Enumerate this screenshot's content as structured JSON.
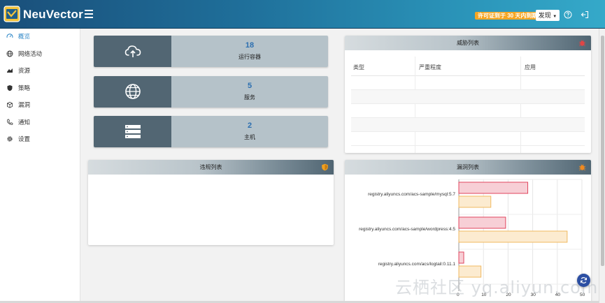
{
  "header": {
    "brand": "NeuVector",
    "license_notice": "许可证到于 30 天内到期!",
    "discover_label": "发现",
    "colors": {
      "topbar_start": "#1a4f7a",
      "topbar_end": "#35a9c9",
      "license_bg": "#f5a623"
    }
  },
  "sidebar": {
    "items": [
      {
        "label": "概览",
        "icon": "dashboard-icon",
        "active": true
      },
      {
        "label": "网络活动",
        "icon": "globe-icon",
        "active": false
      },
      {
        "label": "资源",
        "icon": "resources-icon",
        "active": false
      },
      {
        "label": "策略",
        "icon": "shield-icon",
        "active": false
      },
      {
        "label": "漏洞",
        "icon": "box-icon",
        "active": false
      },
      {
        "label": "通知",
        "icon": "phone-icon",
        "active": false
      },
      {
        "label": "设置",
        "icon": "gear-icon",
        "active": false
      }
    ]
  },
  "stats": [
    {
      "value": "18",
      "label": "运行容器",
      "icon": "cloud-upload-icon"
    },
    {
      "value": "5",
      "label": "服务",
      "icon": "globe-icon"
    },
    {
      "value": "2",
      "label": "主机",
      "icon": "server-icon"
    }
  ],
  "threats_panel": {
    "title": "威胁列表",
    "columns": [
      "类型",
      "严重程度",
      "应用"
    ]
  },
  "violations_panel": {
    "title": "违规列表"
  },
  "vuln_panel": {
    "title": "漏洞列表",
    "chart_data": {
      "type": "bar",
      "orientation": "horizontal",
      "categories": [
        "registry.aliyuncs.com/acs-sample/mysql:5.7",
        "registry.aliyuncs.com/acs-sample/wordpress:4.5",
        "registry.aliyuncs.com/acs/logtail:0.11.1"
      ],
      "series": [
        {
          "color": "#e0455e",
          "fill": "#f7cfd6",
          "values": [
            28,
            19,
            2
          ]
        },
        {
          "color": "#f0b860",
          "fill": "#fcebd0",
          "values": [
            13,
            44,
            9
          ]
        }
      ],
      "xlim": [
        0,
        50
      ],
      "xticks": [
        0,
        10,
        20,
        30,
        40,
        50
      ],
      "grid": true
    }
  },
  "watermark": "云栖社区 yq.aliyun.com"
}
